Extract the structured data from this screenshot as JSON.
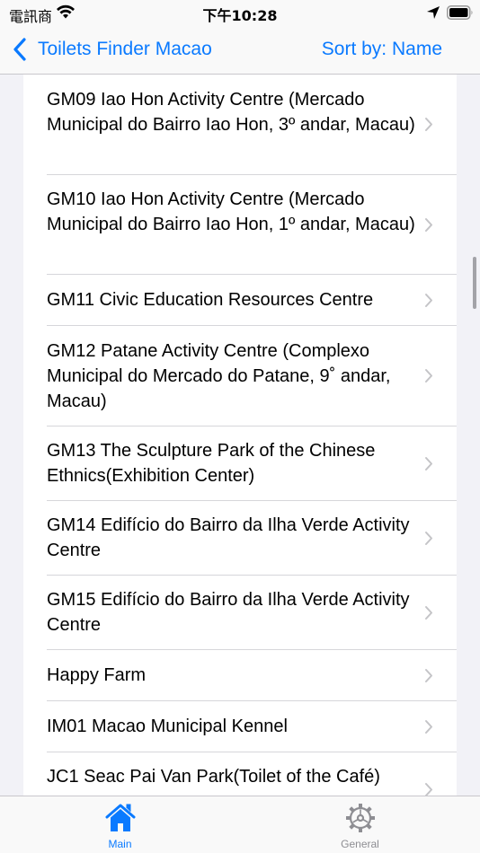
{
  "status_bar": {
    "carrier": "電訊商",
    "time": "下午10:28"
  },
  "nav": {
    "back_label": "Toilets Finder Macao",
    "sort_label": "Sort by: Name"
  },
  "list": {
    "items": [
      {
        "label": "GM09 Iao Hon Activity Centre (Mercado Municipal do Bairro Iao Hon, 3º andar, Macau)"
      },
      {
        "label": "GM10 Iao Hon Activity Centre (Mercado Municipal do Bairro Iao Hon, 1º andar, Macau)"
      },
      {
        "label": "GM11 Civic Education Resources Centre"
      },
      {
        "label": "GM12 Patane Activity Centre (Complexo Municipal do Mercado do Patane, 9˚ andar, Macau)"
      },
      {
        "label": "GM13 The Sculpture Park of the Chinese Ethnics(Exhibition Center)"
      },
      {
        "label": "GM14 Edifício do Bairro da Ilha Verde Activity Centre"
      },
      {
        "label": "GM15 Edifício do Bairro da Ilha Verde Activity Centre"
      },
      {
        "label": "Happy Farm"
      },
      {
        "label": "IM01 Macao Municipal Kennel"
      },
      {
        "label": "JC1 Seac Pai Van Park(Toilet of the Café)"
      }
    ]
  },
  "tab_bar": {
    "tabs": [
      {
        "label": "Main",
        "icon": "house-icon",
        "selected": true
      },
      {
        "label": "General",
        "icon": "gear-icon",
        "selected": false
      }
    ]
  },
  "colors": {
    "accent": "#0a7aff",
    "inactive": "#8e8e93",
    "separator": "#d6d6da",
    "background": "#f2f2f7"
  }
}
